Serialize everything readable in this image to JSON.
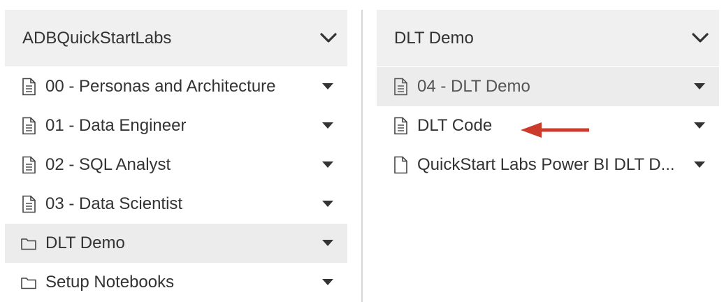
{
  "left_panel": {
    "title": "ADBQuickStartLabs",
    "items": [
      {
        "label": "00 - Personas and Architecture",
        "type": "notebook-icon"
      },
      {
        "label": "01 - Data Engineer",
        "type": "notebook-icon"
      },
      {
        "label": "02 - SQL Analyst",
        "type": "notebook-icon"
      },
      {
        "label": "03 - Data Scientist",
        "type": "notebook-icon"
      },
      {
        "label": "DLT Demo",
        "type": "folder-icon"
      },
      {
        "label": "Setup Notebooks",
        "type": "folder-icon"
      }
    ]
  },
  "right_panel": {
    "title": "DLT Demo",
    "items": [
      {
        "label": "04 - DLT Demo",
        "type": "notebook-icon"
      },
      {
        "label": "DLT Code",
        "type": "notebook-icon"
      },
      {
        "label": "QuickStart Labs Power BI DLT D...",
        "type": "file-icon"
      }
    ]
  },
  "colors": {
    "selected_row": "#ececec",
    "header_bg": "#f0f0f0",
    "annotation_arrow": "#cc3a2b"
  }
}
